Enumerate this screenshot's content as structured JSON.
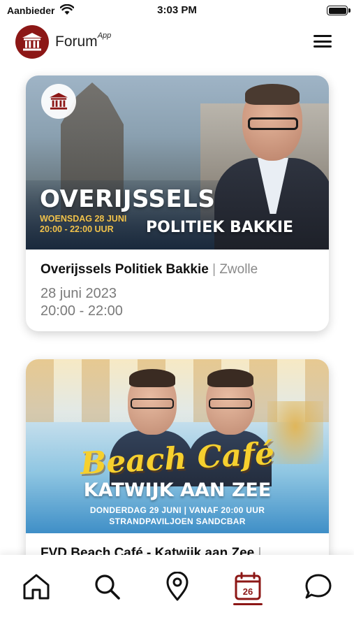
{
  "status_bar": {
    "carrier": "Aanbieder",
    "time": "3:03 PM"
  },
  "header": {
    "app_name": "Forum",
    "app_name_suffix": "App"
  },
  "events": [
    {
      "banner": {
        "title": "OVERIJSSELS",
        "date_line1": "WOENSDAG 28 JUNI",
        "date_line2": "20:00 - 22:00 UUR",
        "subtitle": "POLITIEK BAKKIE"
      },
      "title": "Overijssels Politiek Bakkie",
      "separator": " | ",
      "location": "Zwolle",
      "date": "28 juni 2023",
      "time": "20:00 - 22:00"
    },
    {
      "banner": {
        "script": "Beach Café",
        "title": "KATWIJK AAN ZEE",
        "info_line1": "DONDERDAG 29 JUNI | VANAF 20:00 UUR",
        "info_line2": "STRANDPAVILJOEN SANDCBAR"
      },
      "title": "FVD Beach Café - Katwijk aan Zee",
      "separator": " |"
    }
  ],
  "bottom_nav": {
    "items": [
      "home-icon",
      "search-icon",
      "location-pin-icon",
      "calendar-icon",
      "chat-icon"
    ],
    "active": "calendar-icon",
    "calendar_day": "26"
  },
  "colors": {
    "brand": "#8c1716",
    "text": "#111111",
    "muted": "#8a8a8a",
    "highlight": "#f1c24a"
  }
}
